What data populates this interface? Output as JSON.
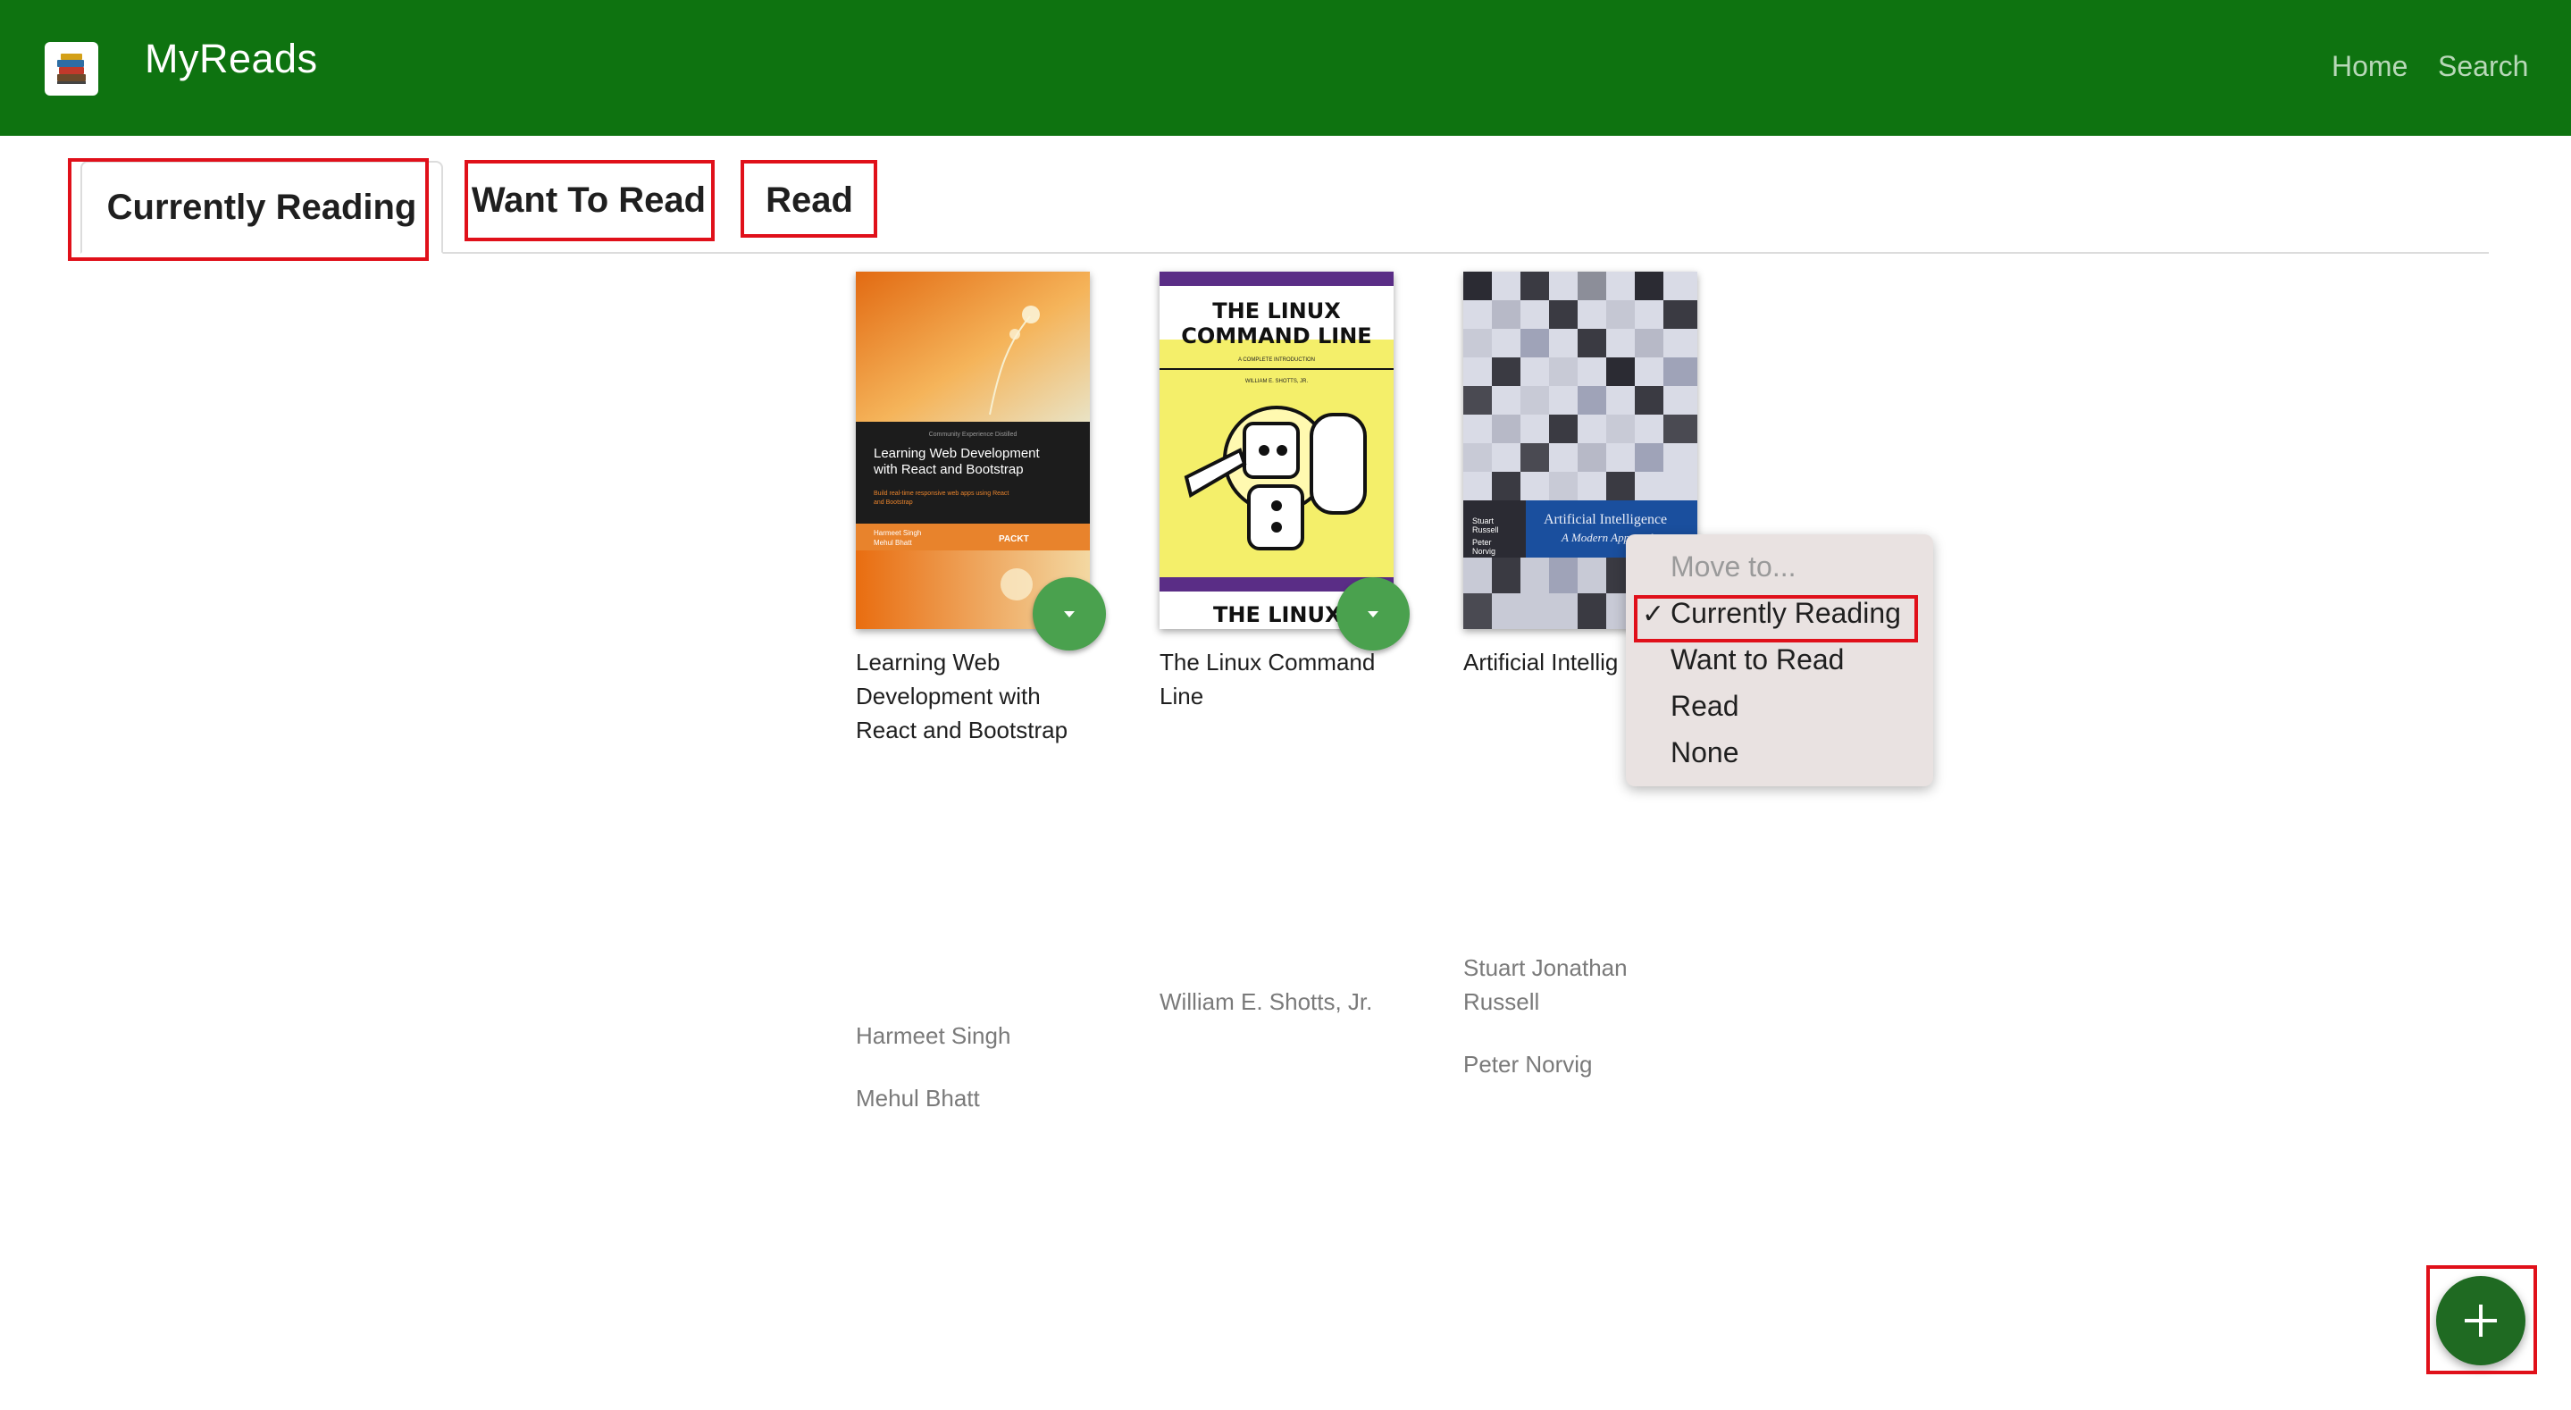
{
  "header": {
    "app_title": "MyReads",
    "nav": {
      "home": "Home",
      "search": "Search"
    },
    "logo_icon": "books-stack-icon"
  },
  "tabs": [
    {
      "label": "Currently Reading",
      "active": true
    },
    {
      "label": "Want To Read",
      "active": false
    },
    {
      "label": "Read",
      "active": false
    }
  ],
  "books": [
    {
      "title": "Learning Web Development with React and Bootstrap",
      "title_lines": [
        "Learning Web",
        "Development with",
        "React and Bootstrap"
      ],
      "authors": [
        "Harmeet Singh",
        "Mehul Bhatt"
      ],
      "cover_text": {
        "title": "Learning Web Development with React and Bootstrap",
        "tagline": "Build real-time responsive web apps using React and Bootstrap",
        "authors": "Harmeet Singh Mehul Bhatt",
        "publisher": "PACKT"
      }
    },
    {
      "title": "The Linux Command Line",
      "title_lines": [
        "The Linux Command",
        "Line"
      ],
      "authors": [
        "William E. Shotts, Jr."
      ],
      "cover_text": {
        "title": "THE LINUX COMMAND LINE",
        "subtitle": "A COMPLETE INTRODUCTION",
        "author": "WILLIAM E. SHOTTS, JR.",
        "footer": "THE LINUX"
      }
    },
    {
      "title": "Artificial Intelligence",
      "title_lines": [
        "Artificial Intellig"
      ],
      "author_lines": [
        "Stuart Jonathan",
        "Russell"
      ],
      "authors": [
        "Stuart Jonathan Russell",
        "Peter Norvig"
      ],
      "cover_text": {
        "title": "Artificial Intelligence",
        "subtitle": "A Modern Approach",
        "authors": "Stuart Russell Peter Norvig"
      }
    }
  ],
  "shelf_menu": {
    "header": "Move to...",
    "options": [
      "Currently Reading",
      "Want to Read",
      "Read",
      "None"
    ],
    "selected": "Currently Reading",
    "check": "✓"
  },
  "fab": {
    "icon": "plus-icon"
  },
  "colors": {
    "header_bg": "#0e7310",
    "shelf_button": "#4aa14e",
    "fab": "#1f6a22",
    "highlight": "#e0101a"
  }
}
